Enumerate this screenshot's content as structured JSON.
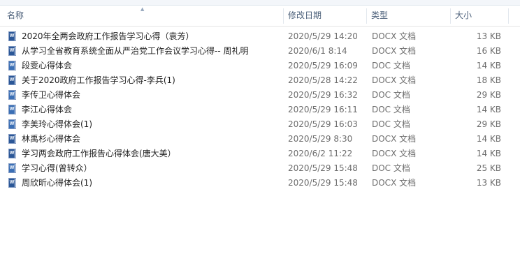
{
  "columns": {
    "name": "名称",
    "date": "修改日期",
    "type": "类型",
    "size": "大小"
  },
  "files": [
    {
      "name": "2020年全两会政府工作报告学习心得（袁芳）",
      "date": "2020/5/29 14:20",
      "type": "DOCX 文档",
      "size": "13 KB",
      "icon": "docx-icon"
    },
    {
      "name": "从学习全省教育系统全面从严治党工作会议学习心得-- 周礼明",
      "date": "2020/6/1 8:14",
      "type": "DOCX 文档",
      "size": "16 KB",
      "icon": "docx-icon"
    },
    {
      "name": "段雯心得体会",
      "date": "2020/5/29 16:09",
      "type": "DOC 文档",
      "size": "14 KB",
      "icon": "doc-icon"
    },
    {
      "name": "关于2020政府工作报告学习心得-李兵(1)",
      "date": "2020/5/28 14:22",
      "type": "DOCX 文档",
      "size": "18 KB",
      "icon": "docx-icon"
    },
    {
      "name": "李传卫心得体会",
      "date": "2020/5/29 16:32",
      "type": "DOC 文档",
      "size": "29 KB",
      "icon": "doc-icon"
    },
    {
      "name": "李江心得体会",
      "date": "2020/5/29 16:11",
      "type": "DOC 文档",
      "size": "14 KB",
      "icon": "doc-icon"
    },
    {
      "name": "李美玲心得体会(1)",
      "date": "2020/5/29 16:03",
      "type": "DOC 文档",
      "size": "29 KB",
      "icon": "doc-icon"
    },
    {
      "name": "林禹杉心得体会",
      "date": "2020/5/29 8:30",
      "type": "DOCX 文档",
      "size": "14 KB",
      "icon": "docx-icon"
    },
    {
      "name": "学习两会政府工作报告心得体会(唐大美）",
      "date": "2020/6/2 11:22",
      "type": "DOCX 文档",
      "size": "14 KB",
      "icon": "docx-icon"
    },
    {
      "name": "学习心得(曾转众）",
      "date": "2020/5/29 15:48",
      "type": "DOC 文档",
      "size": "25 KB",
      "icon": "doc-icon"
    },
    {
      "name": "周欣昕心得体会(1)",
      "date": "2020/5/29 15:48",
      "type": "DOCX 文档",
      "size": "13 KB",
      "icon": "docx-icon"
    }
  ]
}
